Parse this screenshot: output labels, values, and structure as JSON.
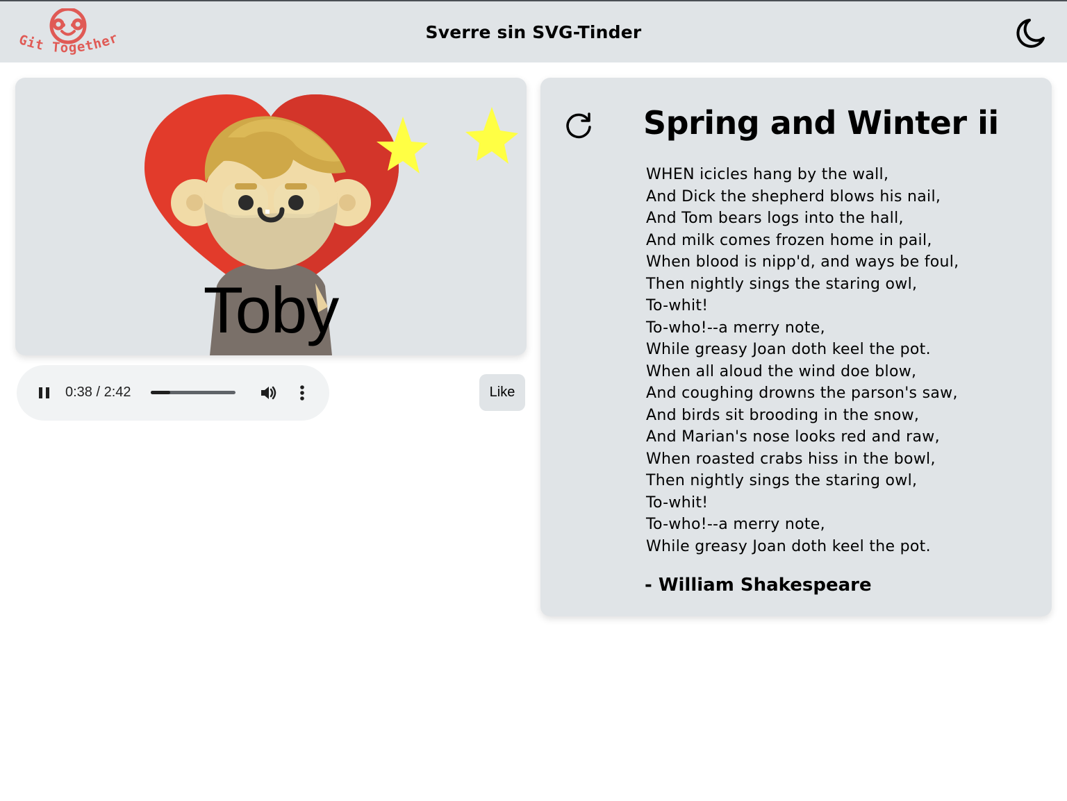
{
  "header": {
    "logo_text": "Git Together",
    "title": "Sverre sin SVG-Tinder",
    "theme_icon": "moon-icon"
  },
  "profile": {
    "name": "Toby",
    "colors": {
      "heart": "#e23b2b",
      "star": "#ffff44",
      "card_bg": "#e0e4e7"
    }
  },
  "audio": {
    "time_display": "0:38 / 2:42",
    "progress": 0.23,
    "play_icon": "pause-icon",
    "volume_icon": "volume-icon",
    "menu_icon": "more-vertical-icon"
  },
  "actions": {
    "like_label": "Like"
  },
  "poem": {
    "refresh_icon": "refresh-icon",
    "title": "Spring and Winter ii",
    "lines": [
      "WHEN icicles hang by the wall,",
      "And Dick the shepherd blows his nail,",
      "And Tom bears logs into the hall,",
      "And milk comes frozen home in pail,",
      "When blood is nipp'd, and ways be foul,",
      "Then nightly sings the staring owl,",
      "To-whit!",
      "To-who!--a merry note,",
      "While greasy Joan doth keel the pot.",
      "When all aloud the wind doe blow,",
      "And coughing drowns the parson's saw,",
      "And birds sit brooding in the snow,",
      "And Marian's nose looks red and raw,",
      "When roasted crabs hiss in the bowl,",
      "Then nightly sings the staring owl,",
      "To-whit!",
      "To-who!--a merry note,",
      "While greasy Joan doth keel the pot."
    ],
    "author": "- William Shakespeare"
  }
}
